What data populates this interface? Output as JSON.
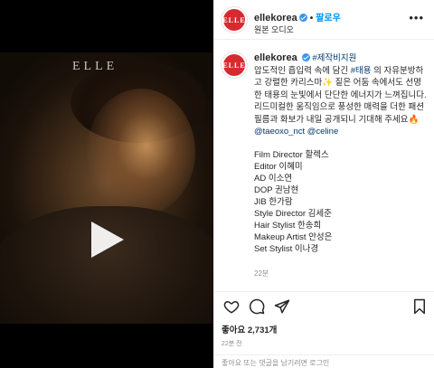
{
  "media": {
    "watermark": "ELLE"
  },
  "post": {
    "avatar_text": "ELLE",
    "username": "ellekorea",
    "follow": "팔로우",
    "audio": "원본 오디오",
    "more": "•••"
  },
  "caption": {
    "username": "ellekorea",
    "hashtag_top": "#제작비지원",
    "text_1": "압도적인 흡입력 속에 담긴 ",
    "hashtag_tae": "#태용",
    "text_2": " 의 자유분방하고 강렬한 카리스마✨ 짙은 어둠 속에서도 선명한 태용의 눈빛에서 단단한 에너지가 느껴집니다. 리드미컬한 움직임으로 풍성한 매력을 더한 패션 필름과 화보가 내일 공개되니 기대해 주세요🔥 ",
    "mention_1": "@taeoxo_nct",
    "mention_2": "@celine",
    "credits": [
      "Film Director 할렉스",
      "Editor 이혜미",
      "AD 이소연",
      "DOP 권남현",
      "JIB 한가람",
      "Style Director 김세준",
      "Hair Stylist 한송희",
      "Makeup Artist 안성은",
      "Set Stylist 이나경"
    ],
    "time": "22분"
  },
  "engagement": {
    "likes": "좋아요 2,731개",
    "time": "22분 전",
    "bottom": "좋아요 또는 댓글을 남기려면 로그인"
  }
}
